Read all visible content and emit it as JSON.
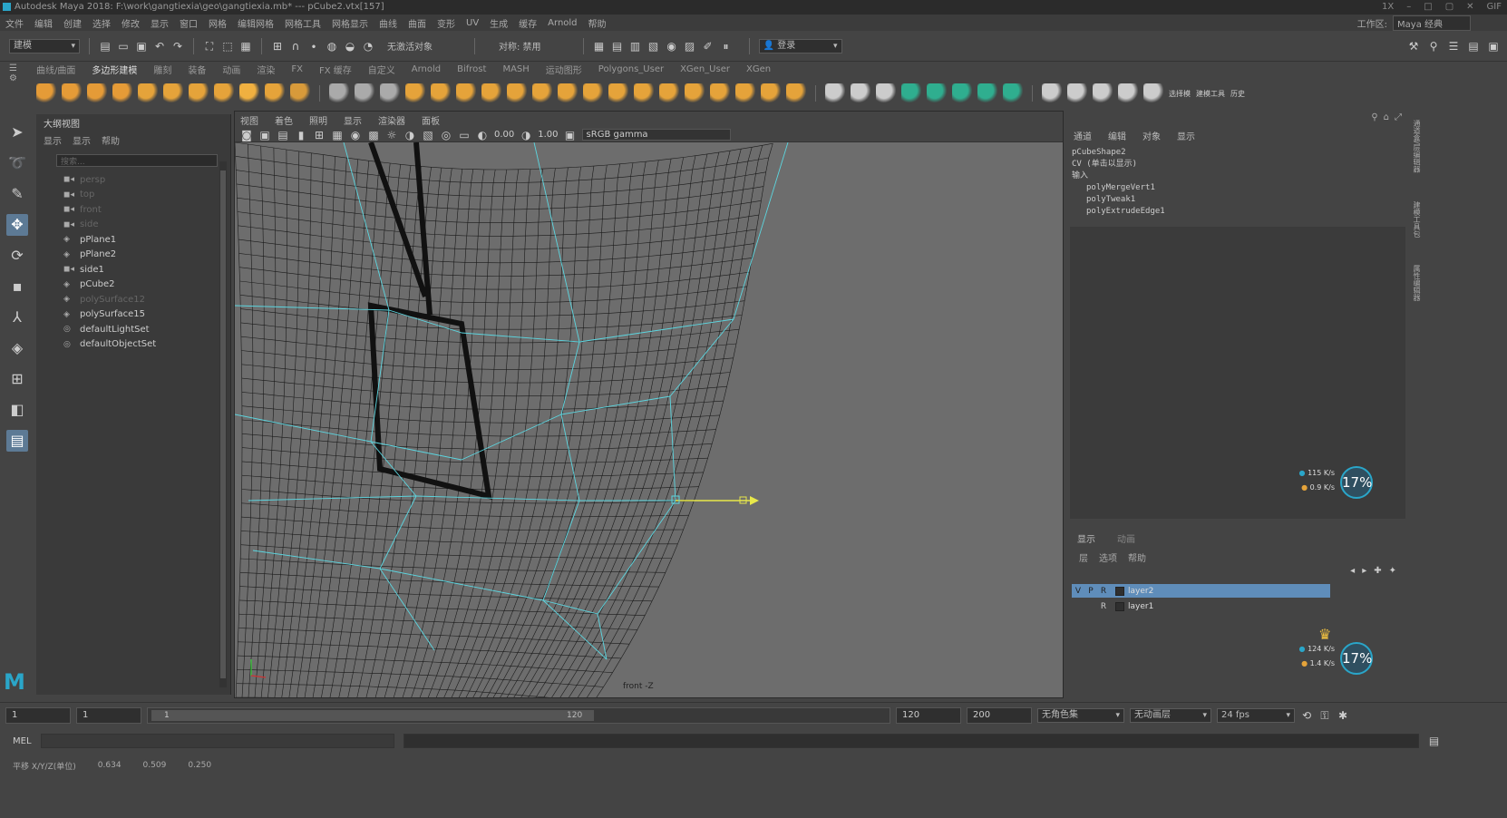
{
  "titlebar": {
    "text": "Autodesk Maya 2018: F:\\work\\gangtiexia\\geo\\gangtiexia.mb*   ---   pCube2.vtx[157]",
    "controls": [
      "1X",
      "–",
      "□",
      "▢",
      "✕",
      "GIF"
    ]
  },
  "menubar": {
    "items": [
      "文件",
      "编辑",
      "创建",
      "选择",
      "修改",
      "显示",
      "窗口",
      "网格",
      "编辑网格",
      "网格工具",
      "网格显示",
      "曲线",
      "曲面",
      "变形",
      "UV",
      "生成",
      "缓存",
      "Arnold",
      "帮助"
    ],
    "workspace_label": "工作区:",
    "workspace_value": "Maya 经典"
  },
  "statusline": {
    "mode": "建模",
    "symmetry_label": "无激活对象",
    "symmetry": "对称: 禁用",
    "login": "登录"
  },
  "shelf": {
    "tabs": [
      "曲线/曲面",
      "多边形建模",
      "雕刻",
      "装备",
      "动画",
      "渲染",
      "FX",
      "FX 缓存",
      "自定义",
      "Arnold",
      "Bifrost",
      "MASH",
      "运动图形",
      "Polygons_User",
      "XGen_User",
      "XGen"
    ],
    "active_tab": "多边形建模",
    "icon_colors": [
      "#e59b37",
      "#e59b37",
      "#e59b37",
      "#e59b37",
      "#e5a33a",
      "#e5a33a",
      "#e5a33a",
      "#e5a33a",
      "#f0b040",
      "#e5a33a",
      "#d89a3a",
      "#aaa",
      "#aaa",
      "#aaa",
      "#e5a33a",
      "#e5a33a",
      "#e5a33a",
      "#e5a33a",
      "#e5a33a",
      "#e5a33a",
      "#e5a33a",
      "#e5a33a",
      "#e5a33a",
      "#e5a33a",
      "#e5a33a",
      "#e5a33a",
      "#e5a33a",
      "#e5a33a",
      "#e5a33a",
      "#e5a33a",
      "#ccc",
      "#ccc",
      "#ccc",
      "#2fae8f",
      "#2fae8f",
      "#2fae8f",
      "#2fae8f",
      "#2fae8f",
      "#ccc",
      "#ccc",
      "#ccc",
      "#ccc",
      "#ccc"
    ],
    "last_labels": [
      "选择模",
      "建模工具",
      "历史"
    ]
  },
  "outliner": {
    "title": "大纲视图",
    "menu": [
      "显示",
      "显示",
      "帮助"
    ],
    "search_placeholder": "搜索...",
    "items": [
      {
        "label": "persp",
        "icon": "camera-icon",
        "dim": true
      },
      {
        "label": "top",
        "icon": "camera-icon",
        "dim": true
      },
      {
        "label": "front",
        "icon": "camera-icon",
        "dim": true
      },
      {
        "label": "side",
        "icon": "camera-icon",
        "dim": true
      },
      {
        "label": "pPlane1",
        "icon": "mesh-icon",
        "dim": false
      },
      {
        "label": "pPlane2",
        "icon": "mesh-icon",
        "dim": false
      },
      {
        "label": "side1",
        "icon": "camera-icon",
        "dim": false
      },
      {
        "label": "pCube2",
        "icon": "mesh-icon",
        "dim": false
      },
      {
        "label": "polySurface12",
        "icon": "mesh-icon",
        "dim": true
      },
      {
        "label": "polySurface15",
        "icon": "mesh-icon",
        "dim": false
      },
      {
        "label": "defaultLightSet",
        "icon": "set-icon",
        "dim": false
      },
      {
        "label": "defaultObjectSet",
        "icon": "set-icon",
        "dim": false
      }
    ]
  },
  "viewport": {
    "menu": [
      "视图",
      "着色",
      "照明",
      "显示",
      "渲染器",
      "面板"
    ],
    "exposure": "0.00",
    "gamma": "1.00",
    "color_space": "sRGB gamma",
    "camera_label": "front -Z"
  },
  "channelbox": {
    "tabs": [
      "通道",
      "编辑",
      "对象",
      "显示"
    ],
    "object": "pCubeShape2",
    "cv_label": "CV (单击以显示)",
    "inputs_label": "输入",
    "inputs": [
      "polyMergeVert1",
      "polyTweak1",
      "polyExtrudeEdge1"
    ]
  },
  "netmonitor_top": {
    "up": "115 K/s",
    "down": "0.9 K/s",
    "percent": "17%"
  },
  "netmonitor_bottom": {
    "up": "124 K/s",
    "down": "1.4 K/s",
    "percent": "17%"
  },
  "layers": {
    "tabs": [
      "显示",
      "动画"
    ],
    "menu": [
      "层",
      "选项",
      "帮助"
    ],
    "rows": [
      {
        "flags": [
          "V",
          "P",
          "R"
        ],
        "name": "layer2",
        "selected": true
      },
      {
        "flags": [
          "",
          "",
          "R"
        ],
        "name": "layer1",
        "selected": false
      }
    ]
  },
  "timeslider": {
    "start": "1",
    "current": "1",
    "range_start": "1",
    "range_end": "120",
    "end": "120",
    "max": "200",
    "character": "无角色集",
    "anim_layer": "无动画层",
    "fps": "24 fps"
  },
  "mel": {
    "label": "MEL"
  },
  "helpline": {
    "label": "平移 X/Y/Z(单位)",
    "x": "0.634",
    "y": "0.509",
    "z": "0.250"
  }
}
